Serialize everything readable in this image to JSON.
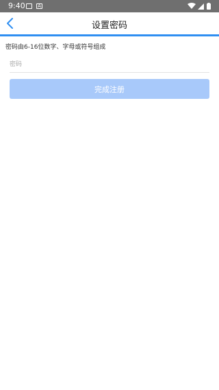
{
  "status_bar": {
    "time": "9:40",
    "icons": [
      "image-icon",
      "font-icon",
      "wifi-icon",
      "signal-icon",
      "battery-icon"
    ]
  },
  "header": {
    "title": "设置密码",
    "back_icon": "chevron-left-icon"
  },
  "colors": {
    "status_bar": "#6f6f6f",
    "accent": "#2f8ef1",
    "button_disabled": "#a8c9fa",
    "back_icon": "#2f8ef1"
  },
  "form": {
    "hint": "密码由6-16位数字、字母或符号组成",
    "password_placeholder": "密码",
    "password_value": "",
    "submit_label": "完成注册"
  }
}
